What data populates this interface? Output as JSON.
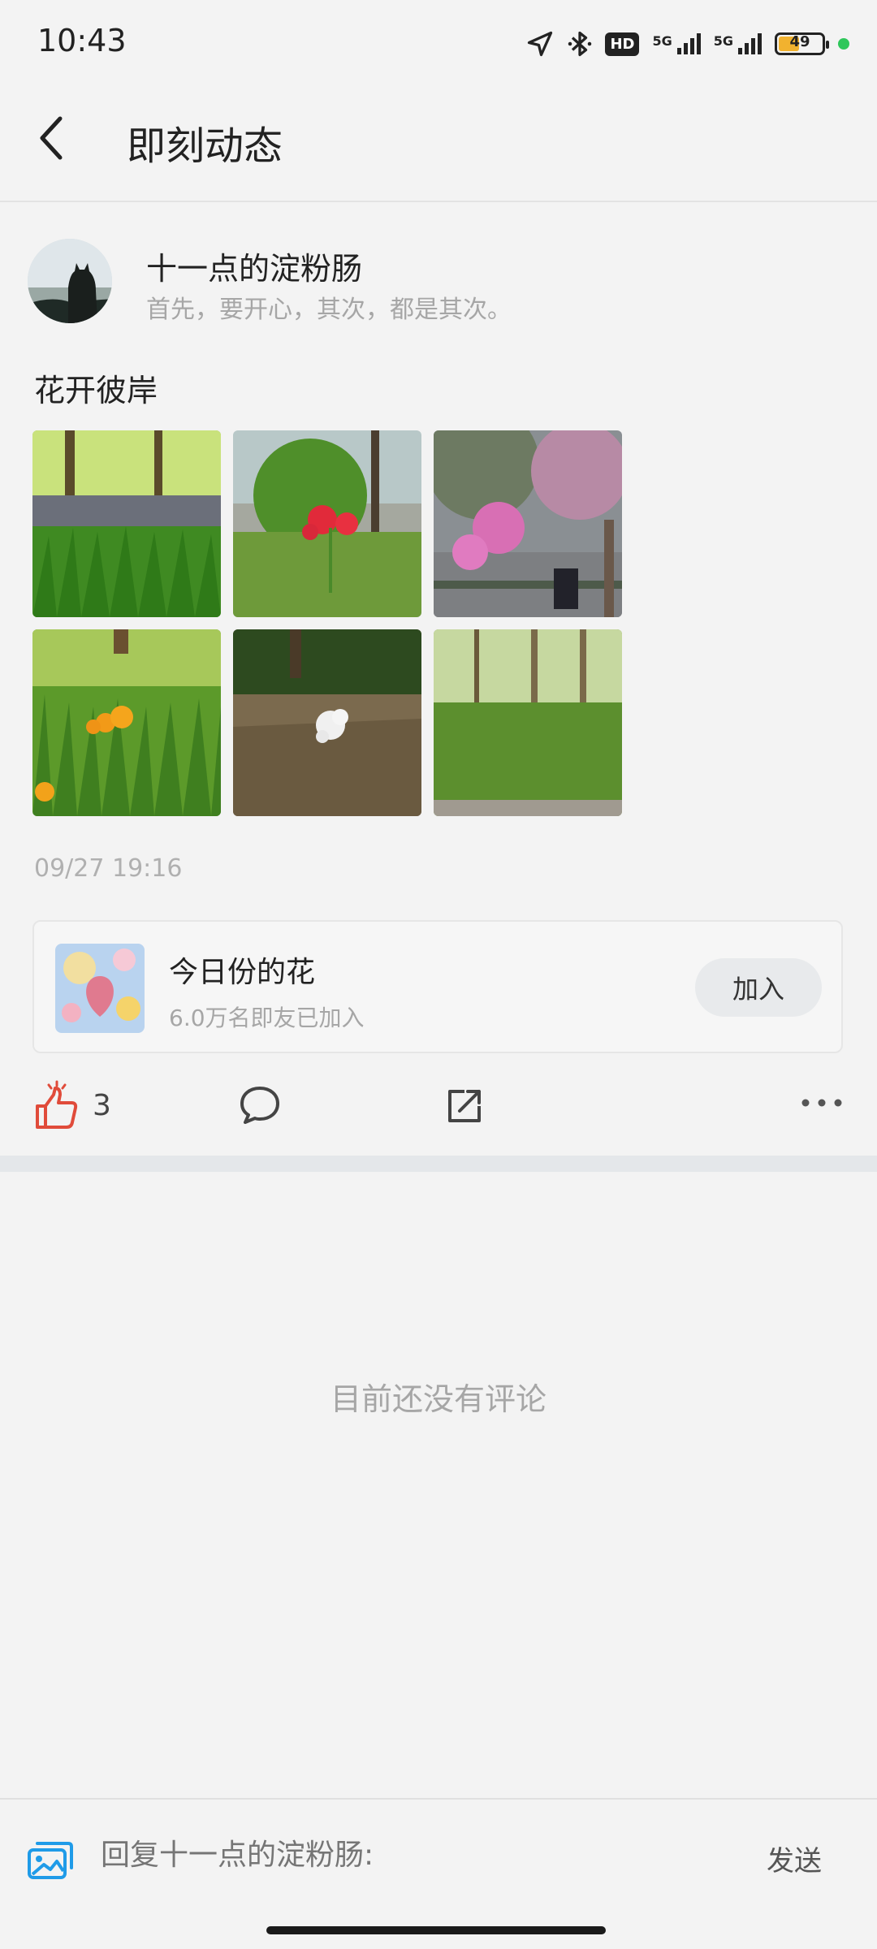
{
  "status_bar": {
    "time": "10:43",
    "hd_badge": "HD",
    "network1": "5G",
    "network2": "5G",
    "battery": "49",
    "battery_level": 0.49,
    "dot_color": "#2ec75a"
  },
  "header": {
    "title": "即刻动态",
    "back_icon": "chevron-left-icon"
  },
  "post": {
    "author_name": "十一点的淀粉肠",
    "author_signature": "首先，要开心，其次，都是其次。",
    "text": "花开彼岸",
    "photo_count": 6,
    "time": "09/27 19:16"
  },
  "topic": {
    "name": "今日份的花",
    "members": "6.0万名即友已加入",
    "join_label": "加入"
  },
  "actions": {
    "like_count": "3",
    "like_color": "#e04b3a",
    "icons": [
      "thumbs-up-icon",
      "comment-icon",
      "share-icon",
      "more-icon"
    ]
  },
  "comments": {
    "empty_text": "目前还没有评论"
  },
  "reply_bar": {
    "placeholder": "回复十一点的淀粉肠:",
    "send_label": "发送",
    "image_icon_color": "#1f9be8"
  }
}
